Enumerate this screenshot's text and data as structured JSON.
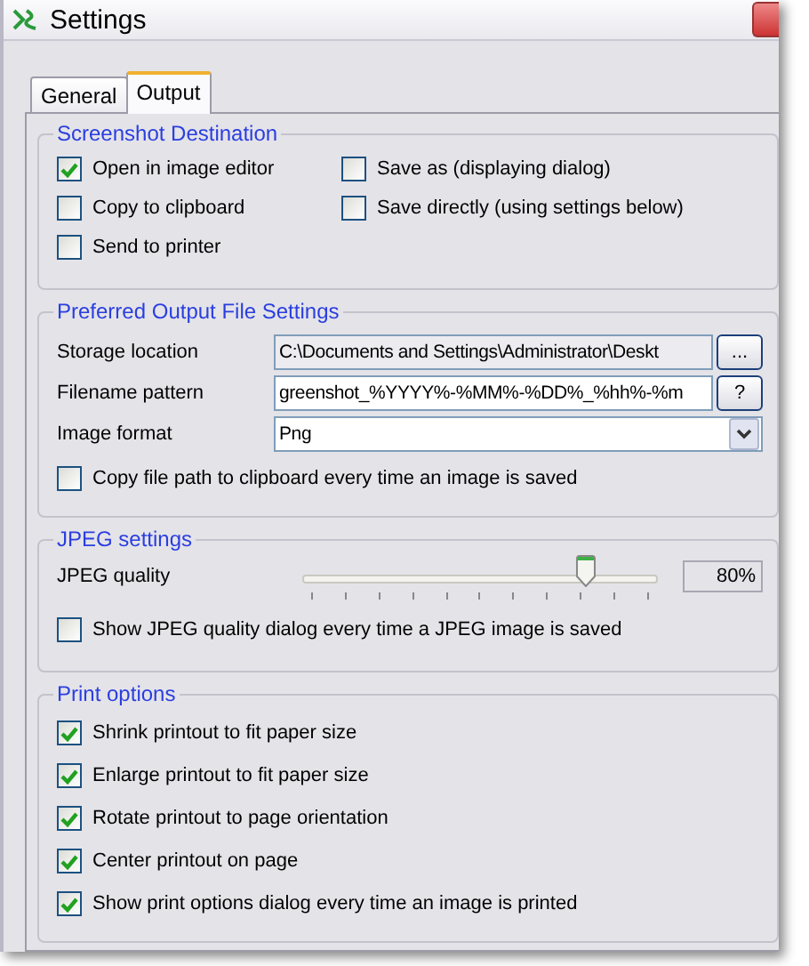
{
  "window": {
    "title": "Settings"
  },
  "tabs": [
    {
      "label": "General",
      "selected": false
    },
    {
      "label": "Output",
      "selected": true
    }
  ],
  "screenshot_destination": {
    "title": "Screenshot Destination",
    "options": [
      {
        "label": "Open in image editor",
        "checked": true
      },
      {
        "label": "Save as (displaying dialog)",
        "checked": false
      },
      {
        "label": "Copy to clipboard",
        "checked": false
      },
      {
        "label": "Save directly (using settings below)",
        "checked": false
      },
      {
        "label": "Send to printer",
        "checked": false
      }
    ]
  },
  "output_file_settings": {
    "title": "Preferred Output File Settings",
    "fields": [
      {
        "kind": "text",
        "label": "Storage location",
        "value": "C:\\Documents and Settings\\Administrator\\Deskt",
        "readonly": true,
        "button": "..."
      },
      {
        "kind": "text",
        "label": "Filename pattern",
        "value": "greenshot_%YYYY%-%MM%-%DD%_%hh%-%m",
        "readonly": false,
        "button": "?"
      },
      {
        "kind": "dropdown",
        "label": "Image format",
        "value": "Png"
      }
    ],
    "options": [
      {
        "label": "Copy file path to clipboard every time an image is saved",
        "checked": false
      }
    ]
  },
  "jpeg_settings": {
    "title": "JPEG settings",
    "quality": {
      "label": "JPEG quality",
      "level": 0.8,
      "reading": "80%"
    },
    "options": [
      {
        "label": "Show JPEG quality dialog every time a JPEG image is saved",
        "checked": false
      }
    ]
  },
  "print_options": {
    "title": "Print options",
    "options": [
      {
        "label": "Shrink printout to fit paper size",
        "checked": true
      },
      {
        "label": "Enlarge printout to fit paper size",
        "checked": true
      },
      {
        "label": "Rotate printout to page orientation",
        "checked": true
      },
      {
        "label": "Center printout on page",
        "checked": true
      },
      {
        "label": "Show print options dialog every time an image is printed",
        "checked": true
      }
    ]
  }
}
